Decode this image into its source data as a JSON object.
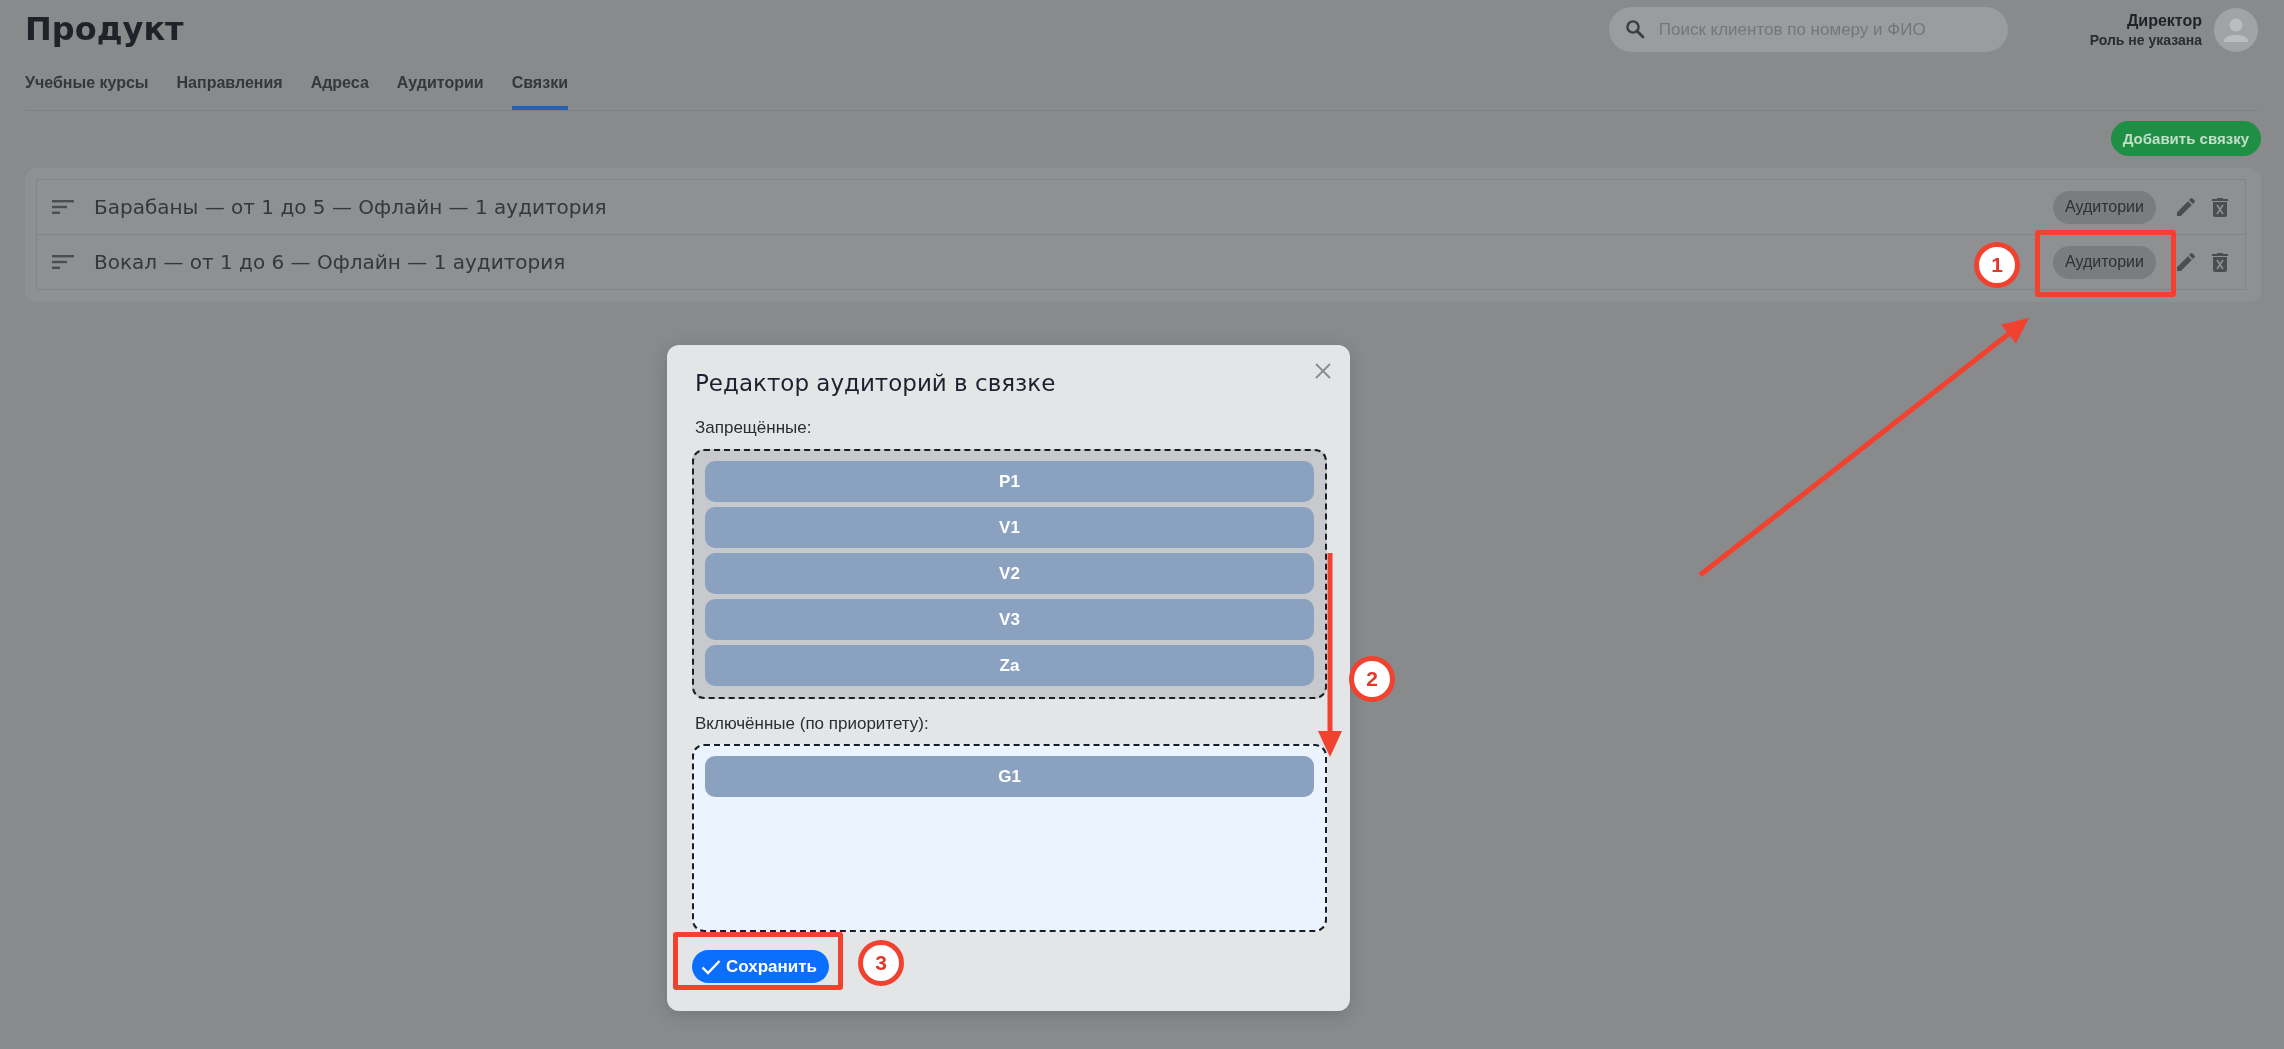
{
  "page": {
    "title": "Продукт"
  },
  "tabs": [
    {
      "label": "Учебные курсы",
      "selected": false
    },
    {
      "label": "Направления",
      "selected": false
    },
    {
      "label": "Адреса",
      "selected": false
    },
    {
      "label": "Аудитории",
      "selected": false
    },
    {
      "label": "Связки",
      "selected": true
    }
  ],
  "search": {
    "placeholder": "Поиск клиентов по номеру и ФИО"
  },
  "user": {
    "name": "Директор",
    "role": "Роль не указана"
  },
  "add_button": "Добавить связку",
  "bundles": [
    {
      "title": "Барабаны — от 1 до 5 — Офлайн — 1 аудитория",
      "rooms_button": "Аудитории"
    },
    {
      "title": "Вокал — от 1 до 6 — Офлайн — 1 аудитория",
      "rooms_button": "Аудитории"
    }
  ],
  "dialog": {
    "title": "Редактор аудиторий в связке",
    "forbidden": {
      "label": "Запрещённые:",
      "items": [
        "P1",
        "V1",
        "V2",
        "V3",
        "Za"
      ]
    },
    "included": {
      "label": "Включённые (по приоритету):",
      "items": [
        "G1"
      ]
    },
    "save_button": "Сохранить"
  },
  "callouts": [
    {
      "number": "1"
    },
    {
      "number": "2"
    },
    {
      "number": "3"
    }
  ]
}
